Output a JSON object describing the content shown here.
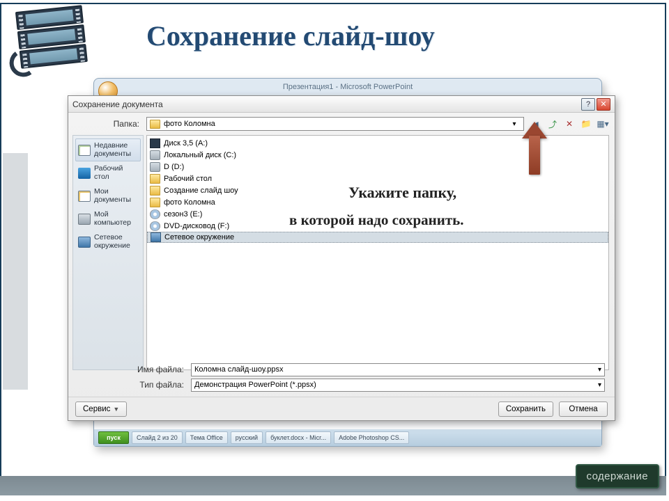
{
  "slide_title": "Сохранение слайд-шоу",
  "ppt_hint": "Презентация1 - Microsoft PowerPoint",
  "dialog": {
    "title": "Сохранение документа",
    "folder_label": "Папка:",
    "folder_value": "фото Коломна",
    "places": [
      {
        "key": "recent",
        "label": "Недавние документы"
      },
      {
        "key": "desk",
        "label": "Рабочий стол"
      },
      {
        "key": "mydocs",
        "label": "Мои документы"
      },
      {
        "key": "comp",
        "label": "Мой компьютер"
      },
      {
        "key": "net",
        "label": "Сетевое окружение"
      }
    ],
    "listing": [
      {
        "icon": "floppy",
        "indent": 0,
        "text": "Диск 3,5 (A:)"
      },
      {
        "icon": "hdd",
        "indent": 0,
        "text": "Локальный диск (C:)"
      },
      {
        "icon": "hdd",
        "indent": 0,
        "text": "D (D:)"
      },
      {
        "icon": "fold",
        "indent": 1,
        "text": "Рабочий стол"
      },
      {
        "icon": "fold",
        "indent": 2,
        "text": "Создание слайд шоу"
      },
      {
        "icon": "fold",
        "indent": 3,
        "text": "фото Коломна"
      },
      {
        "icon": "cd",
        "indent": 0,
        "text": "сезон3 (E:)"
      },
      {
        "icon": "cd",
        "indent": 0,
        "text": "DVD-дисковод (F:)"
      },
      {
        "icon": "net",
        "indent": 0,
        "text": "Сетевое окружение",
        "selected": true
      }
    ],
    "name_label": "Имя файла:",
    "name_value": "Коломна слайд-шоу.ppsx",
    "type_label": "Тип файла:",
    "type_value": "Демонстрация PowerPoint (*.ppsx)",
    "tools_label": "Сервис",
    "save_label": "Сохранить",
    "cancel_label": "Отмена"
  },
  "callout_line1": "Укажите папку,",
  "callout_line2": "в которой надо сохранить.",
  "toc_label": "содержание",
  "taskbar": {
    "start": "пуск",
    "items": [
      "Слайд 2 из 20",
      "Тема Office",
      "русский",
      "буклет.docx - Micr...",
      "",
      "Adobe Photoshop CS..."
    ]
  }
}
